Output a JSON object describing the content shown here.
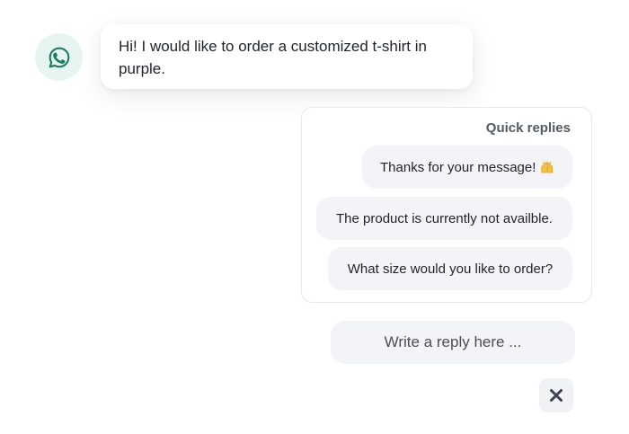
{
  "avatar": {
    "icon": "whatsapp-icon",
    "bg_color": "#e6f5f0",
    "icon_color": "#1f7a62"
  },
  "message": {
    "text": "Hi! I would like to order a customized t-shirt in purple."
  },
  "quick_replies": {
    "title": "Quick replies",
    "items": [
      {
        "label": "Thanks for your message!",
        "emoji": "raising-hands-emoji"
      },
      {
        "label": "The product is currently not availble."
      },
      {
        "label": "What size would you like to order?"
      }
    ]
  },
  "reply": {
    "placeholder": "Write a reply here ...",
    "value": ""
  },
  "close": {
    "icon": "close-icon",
    "color": "#3b4253"
  }
}
